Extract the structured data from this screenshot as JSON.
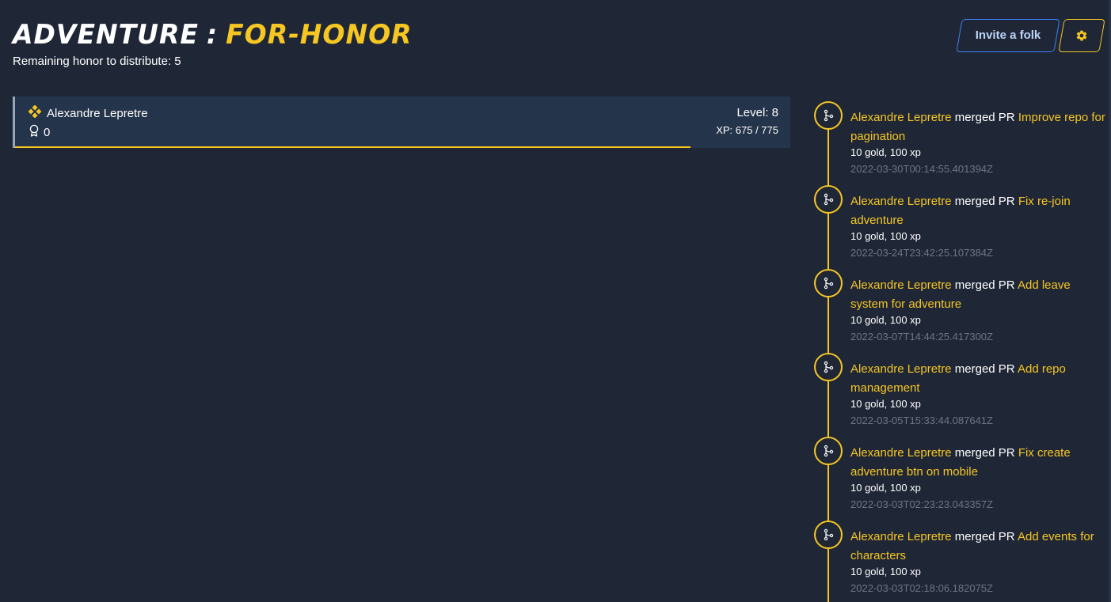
{
  "header": {
    "title_part1": "ADVENTURE",
    "title_separator": ":",
    "title_part2": "FOR-HONOR",
    "remaining_honor_text": "Remaining honor to distribute: 5",
    "invite_label": "Invite a folk",
    "settings_icon": "gear-icon"
  },
  "colors": {
    "background": "#1f2737",
    "accent": "#f6c623",
    "card": "#24344a",
    "invite_border": "#3b82f6"
  },
  "member": {
    "name": "Alexandre Lepretre",
    "honor": "0",
    "level_text": "Level: 8",
    "xp_text": "XP: 675 / 775",
    "xp_progress": 0.871,
    "class_icon": "diamonds-icon",
    "honor_icon": "medal-icon"
  },
  "events": [
    {
      "actor": "Alexandre Lepretre",
      "action": "merged PR",
      "pr_title": "Improve repo for pagination",
      "reward": "10 gold, 100 xp",
      "timestamp": "2022-03-30T00:14:55.401394Z",
      "icon": "merge-icon"
    },
    {
      "actor": "Alexandre Lepretre",
      "action": "merged PR",
      "pr_title": "Fix re-join adventure",
      "reward": "10 gold, 100 xp",
      "timestamp": "2022-03-24T23:42:25.107384Z",
      "icon": "merge-icon"
    },
    {
      "actor": "Alexandre Lepretre",
      "action": "merged PR",
      "pr_title": "Add leave system for adventure",
      "reward": "10 gold, 100 xp",
      "timestamp": "2022-03-07T14:44:25.417300Z",
      "icon": "merge-icon"
    },
    {
      "actor": "Alexandre Lepretre",
      "action": "merged PR",
      "pr_title": "Add repo management",
      "reward": "10 gold, 100 xp",
      "timestamp": "2022-03-05T15:33:44.087641Z",
      "icon": "merge-icon"
    },
    {
      "actor": "Alexandre Lepretre",
      "action": "merged PR",
      "pr_title": "Fix create adventure btn on mobile",
      "reward": "10 gold, 100 xp",
      "timestamp": "2022-03-03T02:23:23.043357Z",
      "icon": "merge-icon"
    },
    {
      "actor": "Alexandre Lepretre",
      "action": "merged PR",
      "pr_title": "Add events for characters",
      "reward": "10 gold, 100 xp",
      "timestamp": "2022-03-03T02:18:06.182075Z",
      "icon": "merge-icon"
    }
  ]
}
